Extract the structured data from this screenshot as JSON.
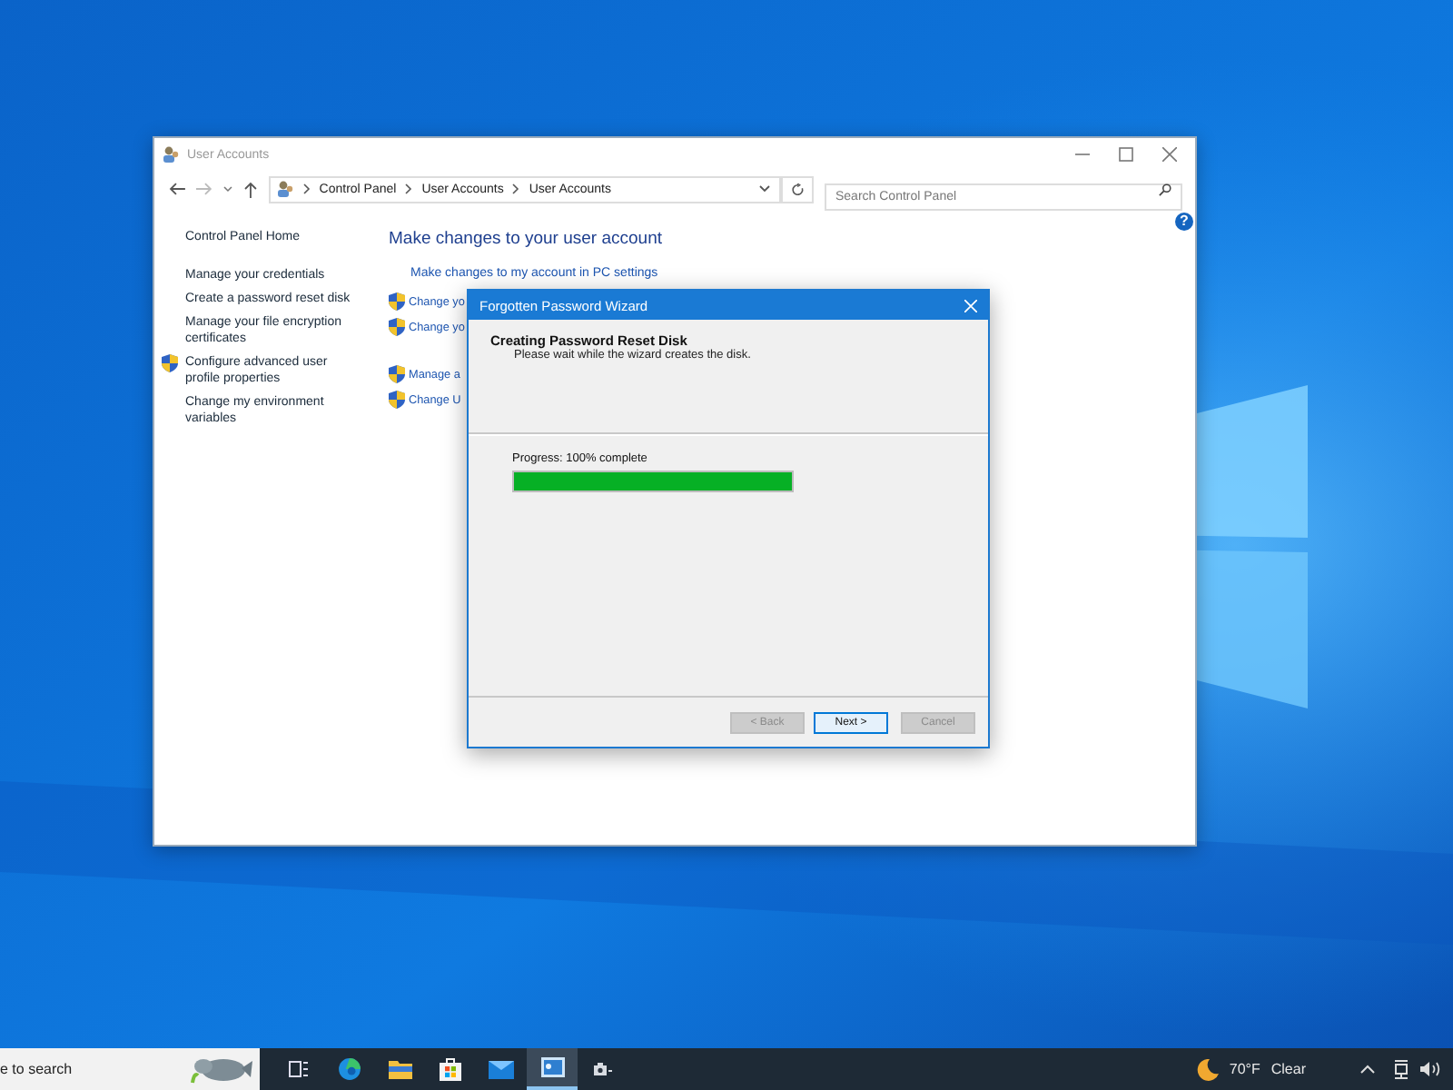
{
  "window": {
    "title": "User Accounts",
    "path": [
      "Control Panel",
      "User Accounts",
      "User Accounts"
    ],
    "search": {
      "placeholder": "Search Control Panel"
    },
    "help_button": "?"
  },
  "sidebar": {
    "items": [
      {
        "text": "Control Panel Home",
        "shield": false
      },
      {
        "text": "Manage your credentials",
        "shield": false
      },
      {
        "text": "Create a password reset disk",
        "shield": false
      },
      {
        "text": "Manage your file encryption certificates",
        "shield": false
      },
      {
        "text": "Configure advanced user profile properties",
        "shield": true
      },
      {
        "text": "Change my environment variables",
        "shield": false
      }
    ]
  },
  "main": {
    "heading": "Make changes to your user account",
    "links": [
      {
        "text": "Make changes to my account in PC settings",
        "shield": false
      },
      {
        "text": "Change yo",
        "shield": true
      },
      {
        "text": "Change yo",
        "shield": true
      },
      {
        "text": "Manage a",
        "shield": true
      },
      {
        "text": "Change U",
        "shield": true
      }
    ]
  },
  "wizard": {
    "title": "Forgotten Password Wizard",
    "heading": "Creating Password Reset Disk",
    "subtitle": "Please wait while the wizard creates the disk.",
    "progress_label": "Progress: 100% complete",
    "level": 1,
    "buttons": [
      {
        "label": "< Back",
        "disabled": true,
        "default": false
      },
      {
        "label": "Next >",
        "disabled": false,
        "default": true
      },
      {
        "label": "Cancel",
        "disabled": true,
        "default": false
      }
    ]
  },
  "taskbar": {
    "search_text": "e to search",
    "apps": [
      {
        "kind": "task-view",
        "selected": false
      },
      {
        "kind": "browser",
        "selected": false
      },
      {
        "kind": "folder",
        "selected": false
      },
      {
        "kind": "store",
        "selected": false
      },
      {
        "kind": "mail",
        "selected": false
      },
      {
        "kind": "control-panel",
        "selected": true
      },
      {
        "kind": "camera",
        "selected": false
      }
    ],
    "weather": {
      "temperature": "70°F",
      "condition": "Clear"
    }
  }
}
